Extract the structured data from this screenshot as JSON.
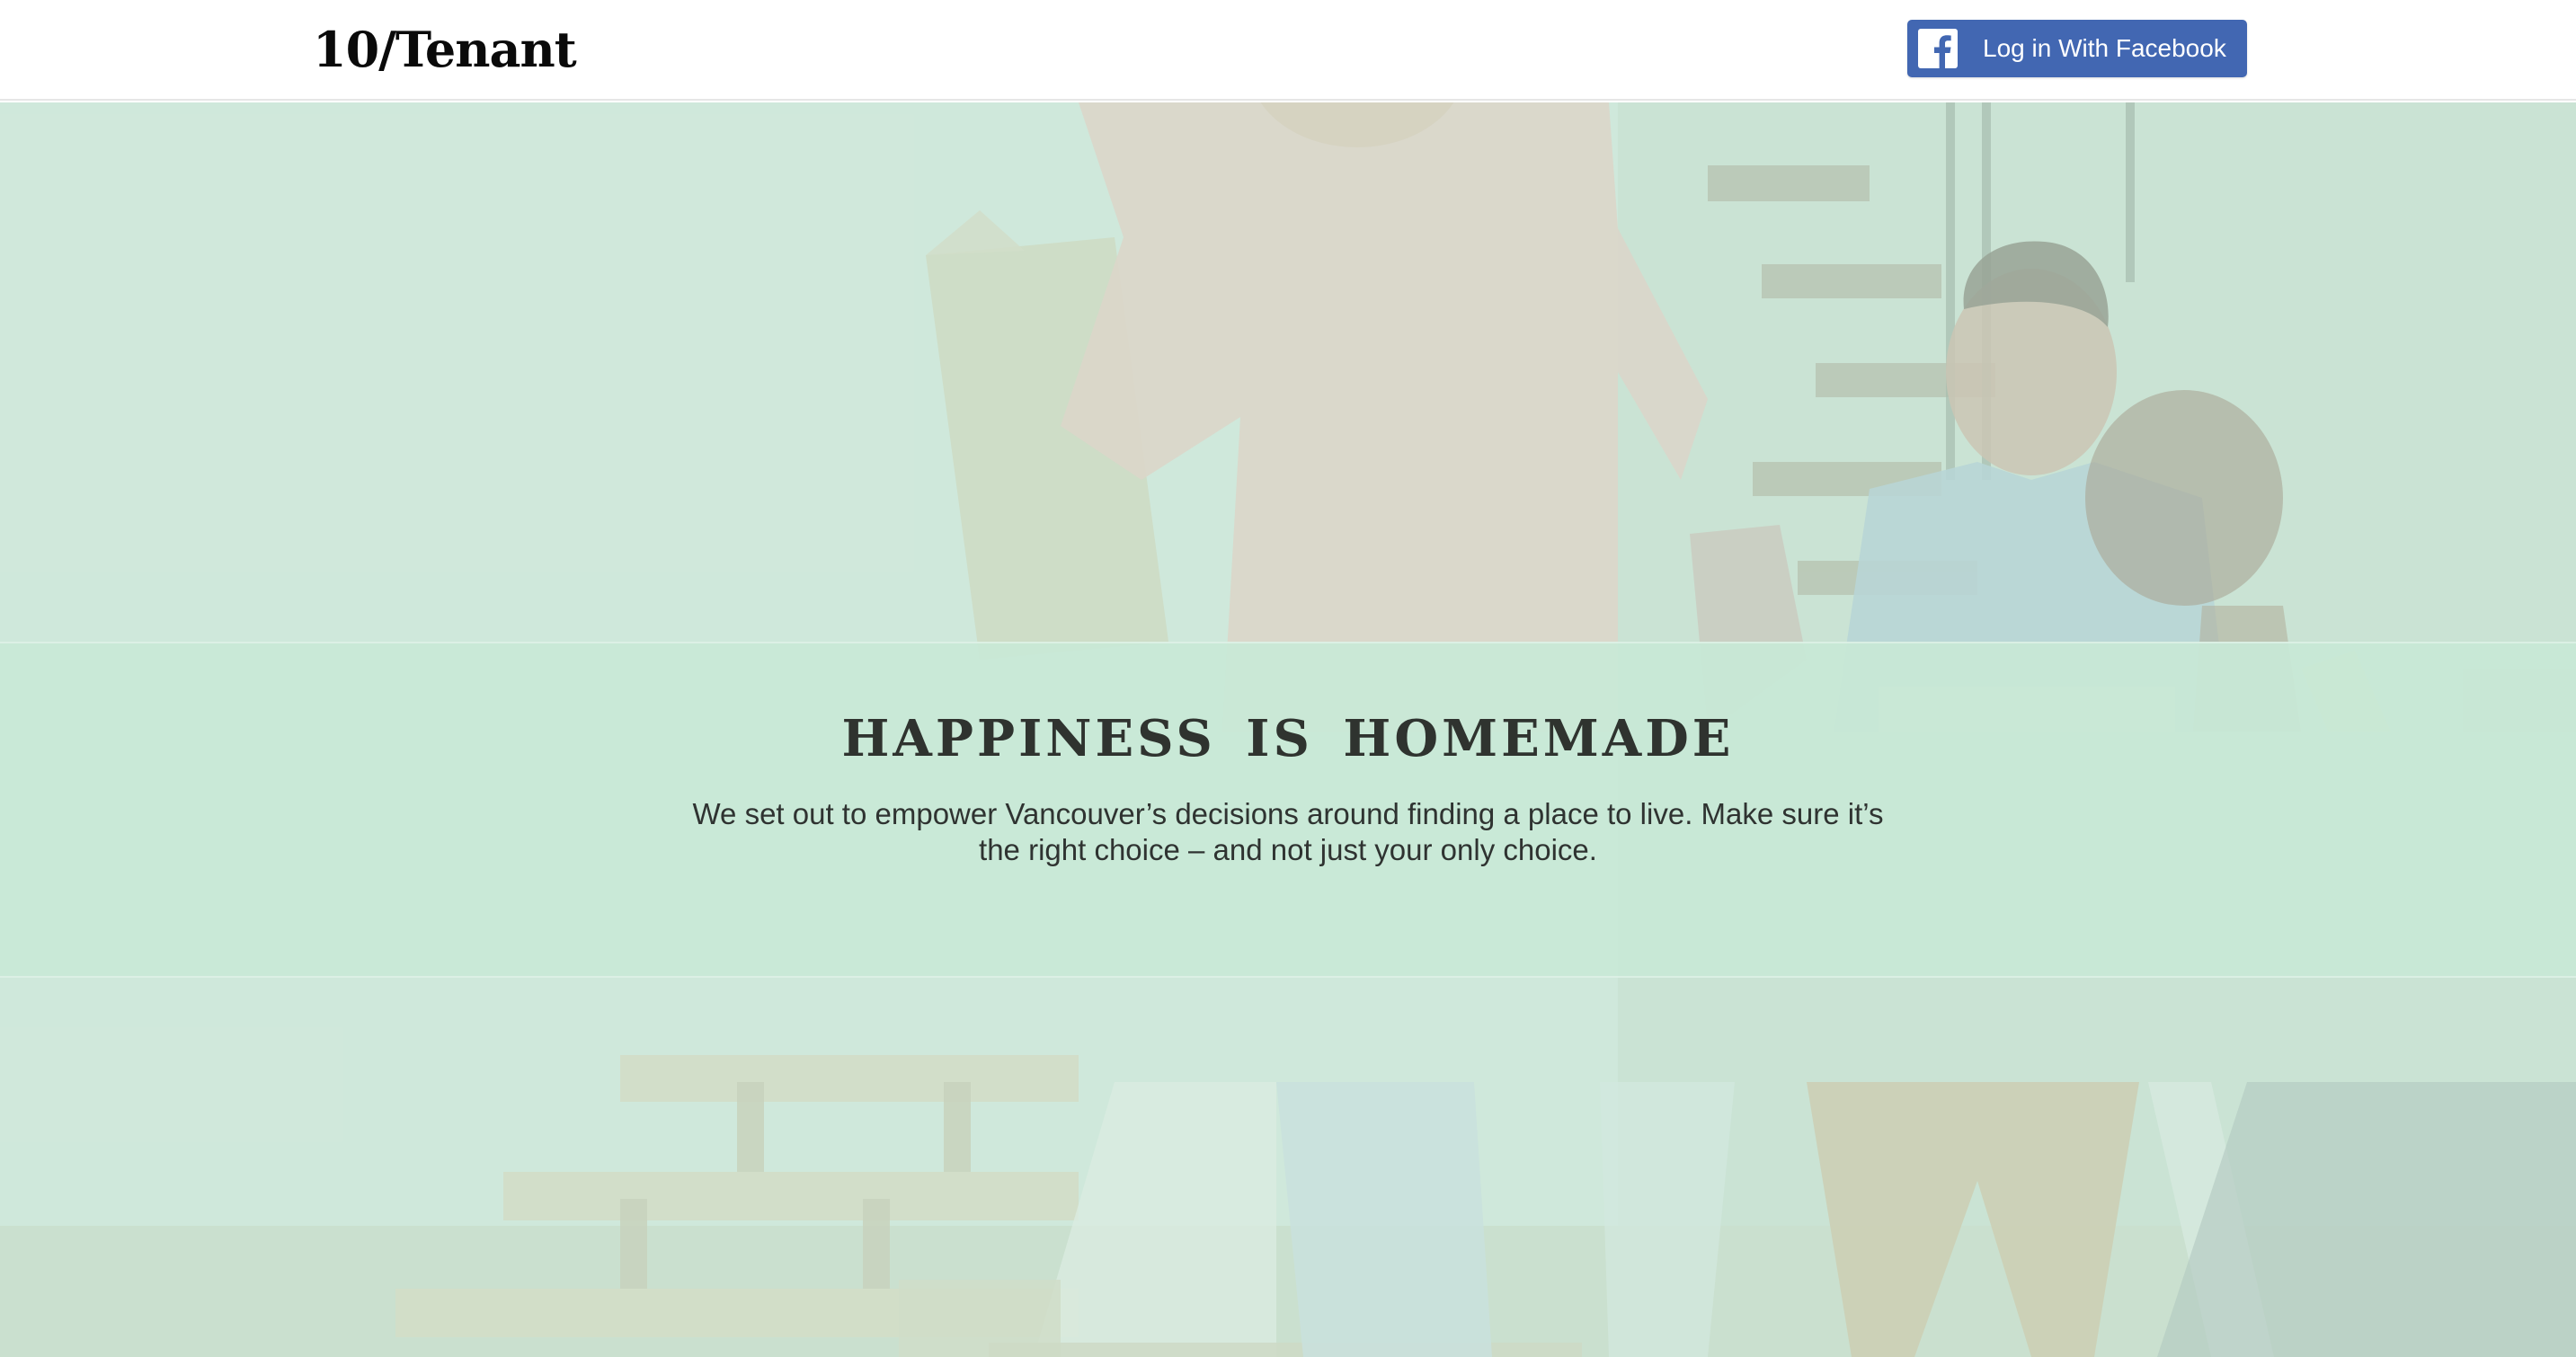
{
  "header": {
    "logo_text": "10/Tenant",
    "login_button_label": "Log in With Facebook",
    "login_button_icon": "facebook-icon",
    "login_button_color": "#4267b2"
  },
  "hero": {
    "background_image": "photo-people-moving-boxes",
    "overlay_color": "#c8e8d6"
  },
  "banner": {
    "title": "HAPPINESS IS HOMEMADE",
    "text": "We set out to empower Vancouver’s decisions around finding a place to live. Make sure it’s the right choice – and not just your only choice."
  }
}
